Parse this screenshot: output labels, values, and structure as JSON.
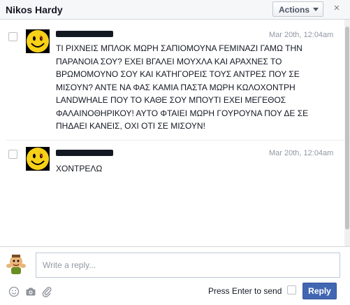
{
  "header": {
    "title": "Nikos Hardy",
    "actions_label": "Actions",
    "close_glyph": "×"
  },
  "messages": [
    {
      "avatar_icon": "smiley-face-icon",
      "time": "Mar 20th, 12:04am",
      "text": "ΤΙ ΡΙΧΝΕΙΣ ΜΠΛΟΚ ΜΩΡΗ ΣΑΠΙΟΜΟΥΝΑ FEMINAZI ΓΑΜΩ ΤΗΝ ΠΑΡΑΝΟΙΑ ΣΟΥ? ΕΧΕΙ ΒΓΑΛΕΙ ΜΟΥΧΛΑ ΚΑΙ ΑΡΑΧΝΕΣ ΤΟ ΒΡΩΜΟΜΟΥΝΟ ΣΟΥ ΚΑΙ ΚΑΤΗΓΟΡΕΙΣ ΤΟΥΣ ΑΝΤΡΕΣ ΠΟΥ ΣΕ ΜΙΣΟΥΝ? ΑΝΤΕ ΝΑ ΦΑΣ ΚΑΜΙΑ ΠΑΣΤΑ ΜΩΡΗ ΚΩΛΟΧΟΝΤΡΗ LANDWHALE ΠΟΥ ΤΟ ΚΑΘΕ ΣΟΥ ΜΠΟΥΤΙ ΕΧΕΙ ΜΕΓΕΘΟΣ ΦΑΛΑΙΝΟΘΗΡΙΚΟΥ! ΑΥΤΟ ΦΤΑΙΕΙ ΜΩΡΗ ΓΟΥΡΟΥΝΑ ΠΟΥ ΔΕ ΣΕ ΠΗΔΑΕΙ ΚΑΝΕΙΣ, ΟΧΙ ΟΤΙ ΣΕ ΜΙΣΟΥΝ!"
    },
    {
      "avatar_icon": "smiley-face-icon",
      "time": "Mar 20th, 12:04am",
      "text": "ΧΟΝΤΡΕΛΩ"
    }
  ],
  "composer": {
    "placeholder": "Write a reply...",
    "value": "",
    "avatar_icon": "cartoon-character-icon",
    "tools": [
      "emoji-icon",
      "camera-icon",
      "paperclip-icon"
    ],
    "press_enter_label": "Press Enter to send",
    "press_enter_checked": false,
    "reply_label": "Reply"
  },
  "colors": {
    "header_bg": "#f6f7f9",
    "reply_button": "#4267b2",
    "timestamp": "#9197a3",
    "smiley_yellow": "#f7d117"
  }
}
